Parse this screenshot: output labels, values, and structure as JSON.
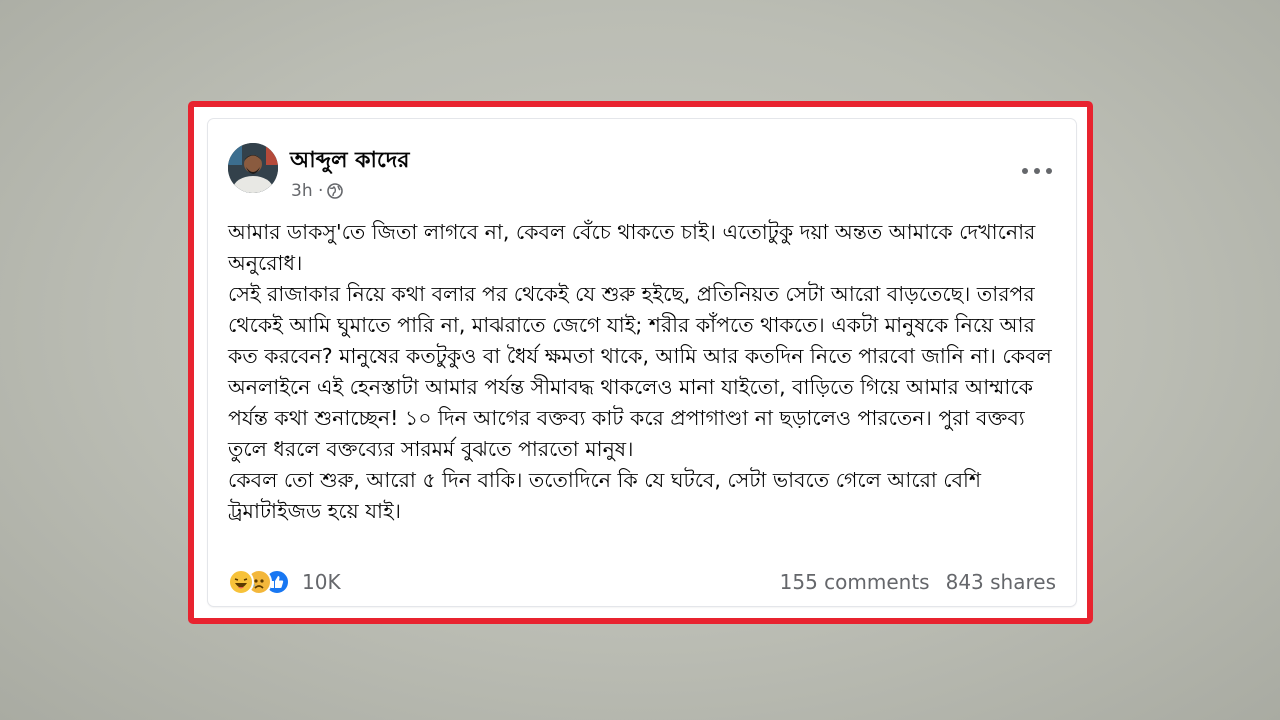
{
  "post": {
    "author": "আব্দুল কাদের",
    "time": "3h ·",
    "privacy_icon": "globe-icon",
    "more_icon": "more-options-icon",
    "text": "আমার ডাকসু'তে জিতা লাগবে না, কেবল বেঁচে থাকতে চাই। এতোটুকু দয়া অন্তত আমাকে দেখানোর অনুরোধ।\nসেই রাজাকার নিয়ে কথা বলার পর থেকেই যে শুরু হইছে, প্রতিনিয়ত সেটা আরো বাড়তেছে। তারপর থেকেই আমি ঘুমাতে পারি না, মাঝরাতে জেগে যাই; শরীর কাঁপতে থাকতে। একটা মানুষকে নিয়ে আর কত করবেন? মানুষের কতটুকুও বা ধৈর্য ক্ষমতা থাকে, আমি আর কতদিন নিতে পারবো জানি না। কেবল অনলাইনে এই হেনস্তাটা আমার পর্যন্ত সীমাবদ্ধ থাকলেও মানা যাইতো, বাড়িতে গিয়ে আমার আম্মাকে পর্যন্ত কথা শুনাচ্ছেন! ১০ দিন আগের বক্তব্য কাট করে প্রপাগাণ্ডা না ছড়ালেও পারতেন। পুরা বক্তব্য তুলে ধরলে বক্তব্যের সারমর্ম বুঝতে পারতো মানুষ।\nকেবল তো শুরু, আরো ৫ দিন বাকি। ততোদিনে কি যে ঘটবে, সেটা ভাবতে গেলে আরো বেশি ট্রমাটাইজড হয়ে যাই।"
  },
  "stats": {
    "reaction_icons": [
      "haha-icon",
      "sad-icon",
      "like-icon"
    ],
    "reactions": "10K",
    "comments": "155 comments",
    "shares": "843 shares"
  },
  "colors": {
    "frame": "#e8232f",
    "like_blue": "#1877f2",
    "secondary_text": "#65676b"
  }
}
